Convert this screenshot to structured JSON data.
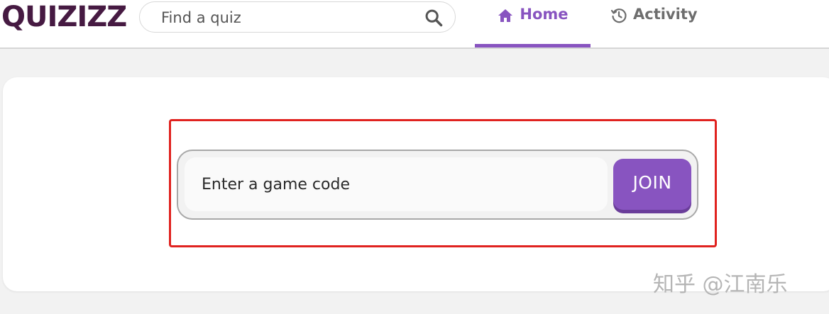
{
  "header": {
    "logo_text": "QUIZIZZ",
    "search": {
      "placeholder": "Find a quiz",
      "value": "",
      "icon": "search-icon"
    },
    "tabs": [
      {
        "label": "Home",
        "icon": "home-icon",
        "active": true
      },
      {
        "label": "Activity",
        "icon": "history-icon",
        "active": false
      }
    ]
  },
  "join": {
    "code_placeholder": "Enter a game code",
    "code_value": "",
    "button_label": "JOIN"
  },
  "watermark": "知乎 @江南乐",
  "colors": {
    "brand": "#461a42",
    "accent": "#8854c0",
    "highlight_border": "#e0221f"
  }
}
